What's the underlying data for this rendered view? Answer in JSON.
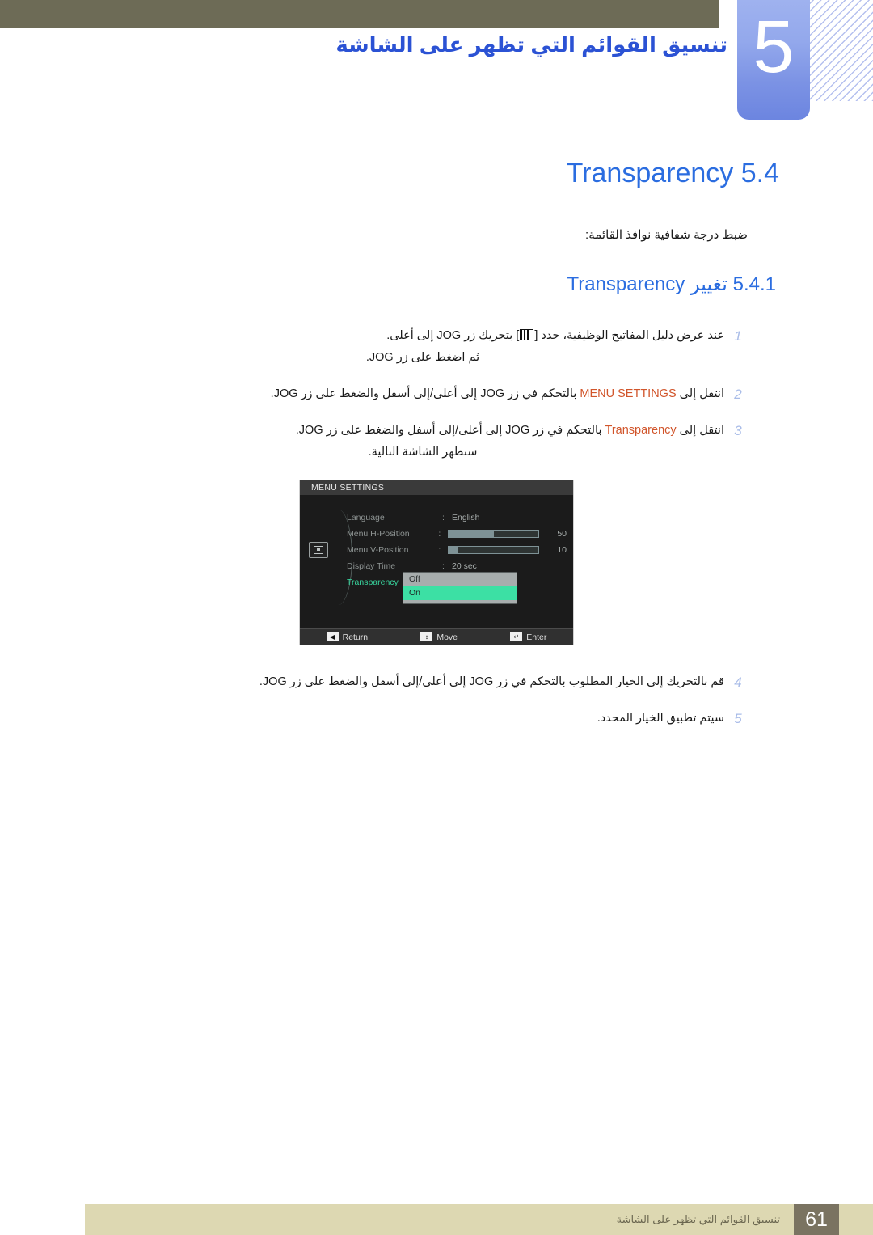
{
  "header": {
    "chapter_number": "5",
    "chapter_title": "تنسيق القوائم التي تظهر على الشاشة"
  },
  "section": {
    "number": "5.4",
    "name": "Transparency",
    "lead_text": "ضبط درجة شفافية نوافذ القائمة:"
  },
  "subsection": {
    "number": "5.4.1",
    "label_ar": "تغيير",
    "label_en": "Transparency"
  },
  "steps": [
    {
      "num": "1",
      "line1_a": "عند عرض دليل المفاتيح الوظيفية، حدد [",
      "line1_b": "] بتحريك زر ",
      "line1_c": "JOG",
      "line1_d": " إلى أعلى.",
      "line2": "ثم اضغط على زر JOG."
    },
    {
      "num": "2",
      "pre": "انتقل إلى ",
      "highlight": "MENU SETTINGS",
      "post": " بالتحكم في زر JOG إلى أعلى/إلى أسفل والضغط على زر JOG."
    },
    {
      "num": "3",
      "pre": "انتقل إلى ",
      "highlight": "Transparency",
      "post": " بالتحكم في زر JOG إلى أعلى/إلى أسفل والضغط على زر JOG.",
      "line2": "ستظهر الشاشة التالية."
    },
    {
      "num": "4",
      "text": "قم بالتحريك إلى الخيار المطلوب بالتحكم في زر JOG إلى أعلى/إلى أسفل والضغط على زر JOG."
    },
    {
      "num": "5",
      "text": "سيتم تطبيق الخيار المحدد."
    }
  ],
  "osd": {
    "title": "MENU SETTINGS",
    "rows": [
      {
        "label": "Language",
        "type": "text",
        "value": "English"
      },
      {
        "label": "Menu H-Position",
        "type": "slider",
        "value": "50",
        "fill": 50
      },
      {
        "label": "Menu V-Position",
        "type": "slider",
        "value": "10",
        "fill": 10
      },
      {
        "label": "Display Time",
        "type": "text",
        "value": "20 sec"
      },
      {
        "label": "Transparency",
        "type": "dropdown",
        "value": ""
      }
    ],
    "dropdown": {
      "options": [
        "Off",
        "On"
      ],
      "selected": "On"
    },
    "footer": [
      {
        "key": "◀",
        "label": "Return"
      },
      {
        "key": "↕",
        "label": "Move"
      },
      {
        "key": "↵",
        "label": "Enter"
      }
    ],
    "colors": {
      "selected_label": "#39d8a0",
      "highlight": "#3ce0a4",
      "slider_fill": "#7e9296"
    }
  },
  "footer": {
    "text": "تنسيق القوائم التي تظهر على الشاشة",
    "page": "61"
  },
  "colors": {
    "top_bar": "#6d6b56",
    "chapter_block": "#7b92e4",
    "heading_blue": "#2b6de0",
    "highlight_orange": "#d1552b",
    "footer_bar": "#ddd8b2",
    "footer_page_box": "#7a7361"
  }
}
